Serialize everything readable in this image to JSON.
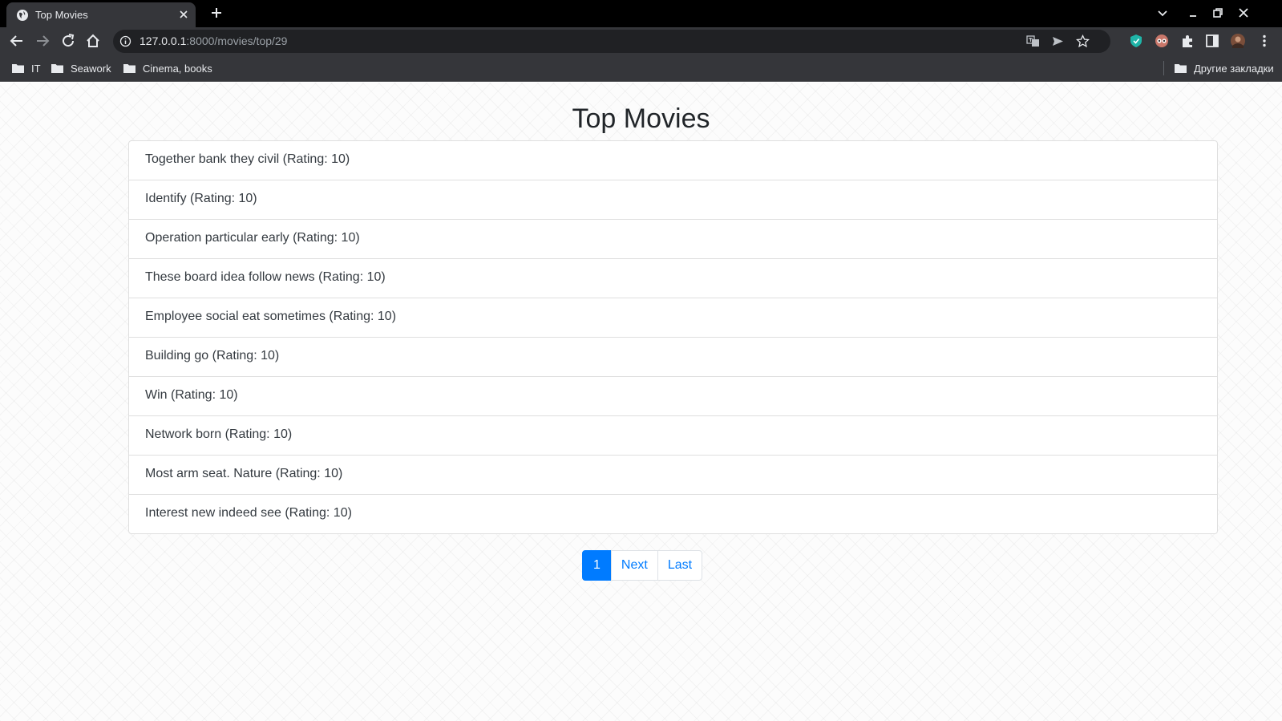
{
  "browser": {
    "tab": {
      "title": "Top Movies"
    },
    "address_bar": {
      "host": "127.0.0.1",
      "path": ":8000/movies/top/29"
    },
    "bookmarks": [
      {
        "label": "IT"
      },
      {
        "label": "Seawork"
      },
      {
        "label": "Cinema, books"
      }
    ],
    "other_bookmarks": {
      "label": "Другие закладки"
    }
  },
  "page": {
    "title": "Top Movies",
    "movies": [
      {
        "text": "Together bank they civil (Rating: 10)"
      },
      {
        "text": "Identify (Rating: 10)"
      },
      {
        "text": "Operation particular early (Rating: 10)"
      },
      {
        "text": "These board idea follow news (Rating: 10)"
      },
      {
        "text": "Employee social eat sometimes (Rating: 10)"
      },
      {
        "text": "Building go (Rating: 10)"
      },
      {
        "text": "Win (Rating: 10)"
      },
      {
        "text": "Network born (Rating: 10)"
      },
      {
        "text": "Most arm seat. Nature (Rating: 10)"
      },
      {
        "text": "Interest new indeed see (Rating: 10)"
      }
    ],
    "pagination": {
      "current": "1",
      "next": "Next",
      "last": "Last"
    }
  },
  "colors": {
    "accent": "#007bff",
    "text": "#343a40",
    "border": "#dfdfdf"
  }
}
